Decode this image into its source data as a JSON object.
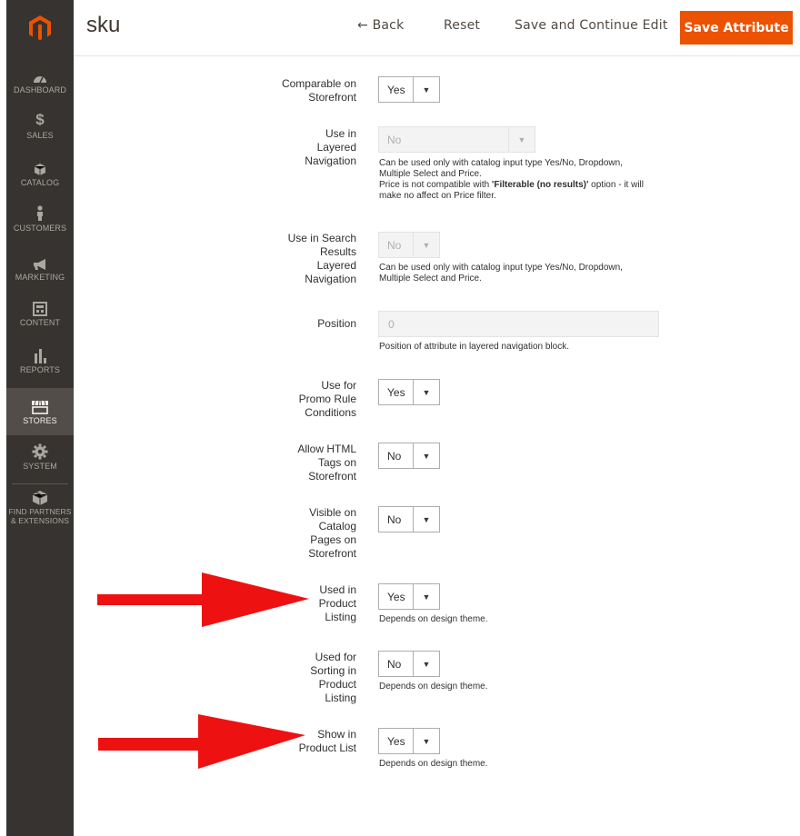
{
  "sidebar": {
    "items": [
      {
        "label": "DASHBOARD",
        "icon": "dashboard-icon"
      },
      {
        "label": "SALES",
        "icon": "dollar-icon"
      },
      {
        "label": "CATALOG",
        "icon": "cube-icon"
      },
      {
        "label": "CUSTOMERS",
        "icon": "person-icon"
      },
      {
        "label": "MARKETING",
        "icon": "megaphone-icon"
      },
      {
        "label": "CONTENT",
        "icon": "layout-icon"
      },
      {
        "label": "REPORTS",
        "icon": "bar-chart-icon"
      },
      {
        "label": "STORES",
        "icon": "store-icon"
      },
      {
        "label": "SYSTEM",
        "icon": "gear-icon"
      },
      {
        "label": "FIND PARTNERS & EXTENSIONS",
        "icon": "box-icon"
      }
    ],
    "active": "STORES"
  },
  "header": {
    "title": "sku",
    "back_label": "Back",
    "reset_label": "Reset",
    "continue_label": "Save and Continue Edit",
    "save_label": "Save Attribute",
    "accent": "#eb5202"
  },
  "form": {
    "comparable": {
      "label": "Comparable on Storefront",
      "value": "Yes"
    },
    "layered_nav": {
      "label": "Use in Layered Navigation",
      "value": "No",
      "note_1": "Can be used only with catalog input type Yes/No, Dropdown, Multiple Select and Price.",
      "note_2a": "Price is not compatible with ",
      "note_2b": "'Filterable (no results)'",
      "note_2c": " option - it will make no affect on Price filter."
    },
    "search_layered_nav": {
      "label": "Use in Search Results Layered Navigation",
      "value": "No",
      "note": "Can be used only with catalog input type Yes/No, Dropdown, Multiple Select and Price."
    },
    "position": {
      "label": "Position",
      "value": "0",
      "note": "Position of attribute in layered navigation block."
    },
    "promo_rule": {
      "label": "Use for Promo Rule Conditions",
      "value": "Yes"
    },
    "html_tags": {
      "label": "Allow HTML Tags on Storefront",
      "value": "No"
    },
    "visible_catalog": {
      "label": "Visible on Catalog Pages on Storefront",
      "value": "No"
    },
    "product_listing": {
      "label": "Used in Product Listing",
      "value": "Yes",
      "note": "Depends on design theme."
    },
    "sorting": {
      "label": "Used for Sorting in Product Listing",
      "value": "No",
      "note": "Depends on design theme."
    },
    "product_list": {
      "label": "Show in Product List",
      "value": "Yes",
      "note": "Depends on design theme."
    }
  },
  "annotation_color": "#ee1111"
}
